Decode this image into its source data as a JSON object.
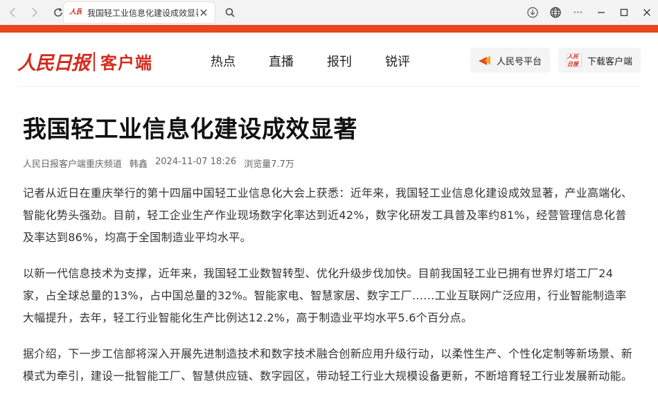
{
  "browser": {
    "tab_title": "我国轻工业信息化建设成效显著",
    "tab_favicon_text": "人民日报"
  },
  "site": {
    "logo_main": "人民日报",
    "logo_sub": "客户端",
    "nav": [
      "热点",
      "直播",
      "报刊",
      "锐评"
    ],
    "actions": {
      "platform": "人民号平台",
      "download": "下载客户端"
    },
    "accent_color": "#e8471c"
  },
  "article": {
    "title": "我国轻工业信息化建设成效显著",
    "source": "人民日报客户端重庆频道",
    "author": "韩鑫",
    "datetime": "2024-11-07 18:26",
    "views": "浏览量7.7万",
    "paragraphs": [
      "记者从近日在重庆举行的第十四届中国轻工业信息化大会上获悉：近年来，我国轻工业信息化建设成效显著，产业高端化、智能化势头强劲。目前，轻工企业生产作业现场数字化率达到近42%，数字化研发工具普及率约81%，经营管理信息化普及率达到86%，均高于全国制造业平均水平。",
      "以新一代信息技术为支撑，近年来，我国轻工业数智转型、优化升级步伐加快。目前我国轻工业已拥有世界灯塔工厂24家，占全球总量的13%，占中国总量的32%。智能家电、智慧家居、数字工厂……工业互联网广泛应用，行业智能制造率大幅提升，去年，轻工行业智能化生产比例达12.2%，高于制造业平均水平5.6个百分点。",
      "据介绍，下一步工信部将深入开展先进制造技术和数字技术融合创新应用升级行动，以柔性生产、个性化定制等新场景、新模式为牵引，建设一批智能工厂、智慧供应链、数字园区，带动轻工行业大规模设备更新，不断培育轻工行业发展新动能。"
    ]
  }
}
